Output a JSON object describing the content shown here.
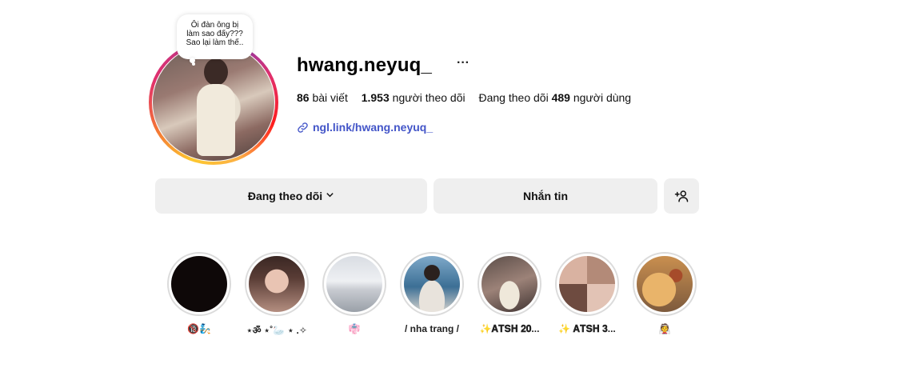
{
  "profile": {
    "username": "hwang.neyuq_",
    "more_glyph": "···",
    "note": [
      "Ôi đàn ông bị",
      "làm sao đấy???",
      "Sao lại làm thế.."
    ],
    "stats": {
      "posts_count": "86",
      "posts_label": "bài viết",
      "followers_count": "1.953",
      "followers_label": "người theo dõi",
      "following_prefix": "Đang theo dõi",
      "following_count": "489",
      "following_label": "người dùng"
    },
    "link": "ngl.link/hwang.neyuq_"
  },
  "actions": {
    "follow_label": "Đang theo dõi",
    "follow_chevron": "⌄",
    "message_label": "Nhắn tin"
  },
  "highlights": [
    {
      "label": "🔞🧞"
    },
    {
      "label": "⋆ॐ ⋆˚🦢 ⋆ .✧"
    },
    {
      "label": "👘"
    },
    {
      "label": "/ nha trang /"
    },
    {
      "label": "✨𝐀𝐓𝐒𝐇 𝟐𝟎..."
    },
    {
      "label": "✨ 𝐀𝐓𝐒𝐇 𝟑..."
    },
    {
      "label": "👰"
    }
  ],
  "colors": {
    "link": "#4355c8",
    "button_bg": "#efefef",
    "ring_border": "#dbdbdb"
  }
}
